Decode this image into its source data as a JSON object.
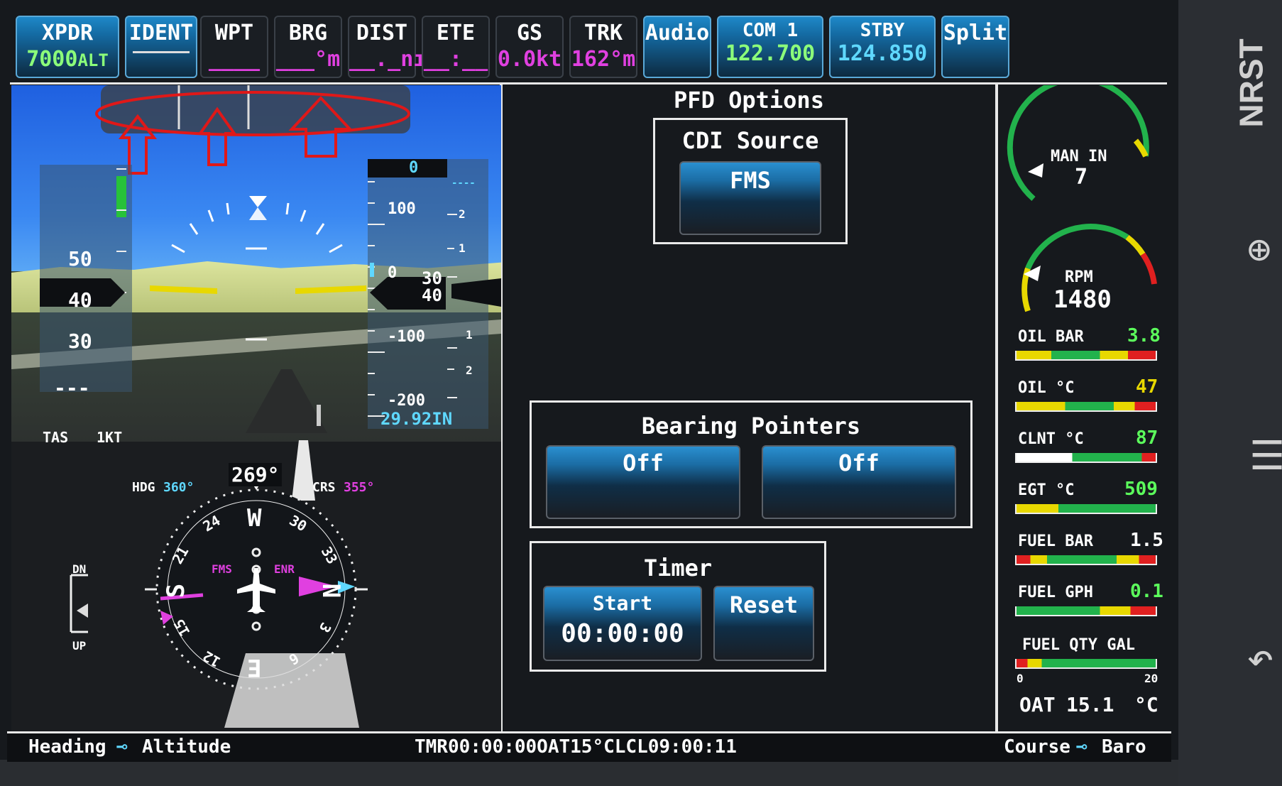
{
  "topbar": {
    "xpdr_label": "XPDR",
    "xpdr_code": "7000",
    "xpdr_mode": "ALT",
    "ident": "IDENT",
    "wpt_label": "WPT",
    "wpt_value": "____",
    "brg_label": "BRG",
    "brg_value": "___°m",
    "dist_label": "DIST",
    "dist_value": "__._nı",
    "ete_label": "ETE",
    "ete_value": "__:__",
    "gs_label": "GS",
    "gs_value": "0.0kt",
    "trk_label": "TRK",
    "trk_value": "162°m",
    "audio": "Audio",
    "com1_label": "COM 1",
    "com1_value": "122.700",
    "stby_label": "STBY",
    "stby_value": "124.850",
    "split": "Split"
  },
  "pfd": {
    "speed_ticks": [
      "50",
      "40",
      "30"
    ],
    "speed_box": "---",
    "alt_selected": "0",
    "alt_ticks": [
      "100",
      "0",
      "-100",
      "-200"
    ],
    "alt_readout_top": "30",
    "alt_readout_bottom": "40",
    "vs_ticks": [
      "----",
      "2",
      "1",
      "1",
      "2"
    ],
    "baro": "29.92IN",
    "tas_label": "TAS",
    "tas_value": "1KT",
    "hdg_label": "HDG",
    "hdg_value": "360°",
    "crs_label": "CRS",
    "crs_value": "355°",
    "heading_readout": "269°",
    "compass_w": "W",
    "compass_s": "S",
    "compass_n": "N",
    "compass_e": "E",
    "compass_nums": [
      "24",
      "30",
      "33",
      "21",
      "15",
      "12",
      "6",
      "3"
    ],
    "fms_tag": "FMS",
    "enr_tag": "ENR",
    "vsi_dn": "DN",
    "vsi_up": "UP"
  },
  "options": {
    "title": "PFD Options",
    "cdi_label": "CDI Source",
    "cdi_value": "FMS",
    "bearing_label": "Bearing Pointers",
    "bearing_1": "Off",
    "bearing_2": "Off",
    "timer_label": "Timer",
    "timer_start": "Start",
    "timer_value": "00:00:00",
    "timer_reset": "Reset"
  },
  "eis": {
    "man_label": "MAN IN",
    "man_value": "7",
    "rpm_label": "RPM",
    "rpm_value": "1480",
    "oil_bar_label": "OIL BAR",
    "oil_bar_value": "3.8",
    "oil_c_label": "OIL °C",
    "oil_c_value": "47",
    "clnt_label": "CLNT °C",
    "clnt_value": "87",
    "egt_label": "EGT °C",
    "egt_value": "509",
    "fuel_bar_label": "FUEL BAR",
    "fuel_bar_value": "1.5",
    "fuel_gph_label": "FUEL GPH",
    "fuel_gph_value": "0.1",
    "fuel_qty_label": "FUEL QTY GAL",
    "fuel_qty_min": "0",
    "fuel_qty_max": "20",
    "oat_label": "OAT",
    "oat_value": "15.1",
    "oat_unit": "°C"
  },
  "bottom": {
    "left_a": "Heading",
    "left_b": "Altitude",
    "center": "TMR00:00:00OAT15°CLCL09:00:11",
    "right_a": "Course",
    "right_b": "Baro"
  },
  "sidebar": {
    "nrst": "NRST"
  },
  "colors": {
    "magenta": "#e040e0",
    "green": "#5cff5c",
    "cyan": "#5fd8ff",
    "accent_blue": "#1e88c8",
    "annotation_red": "#e01818"
  }
}
